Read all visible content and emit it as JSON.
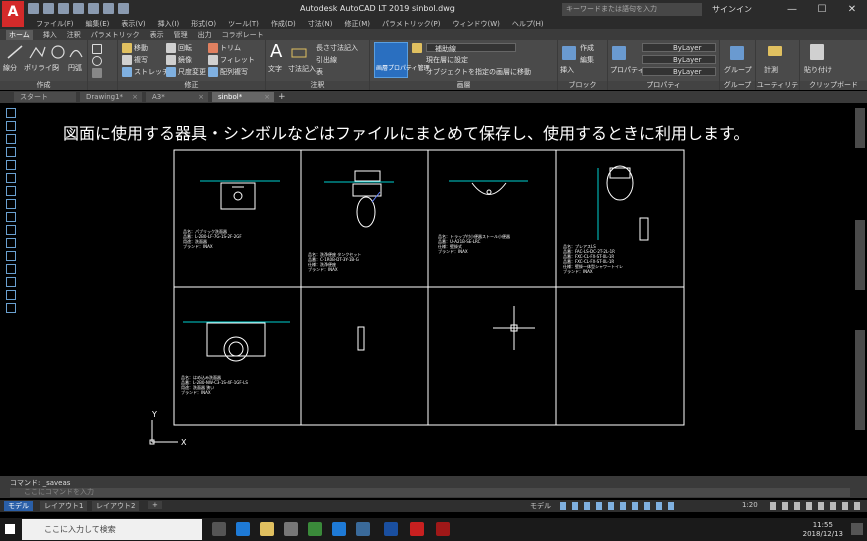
{
  "app": {
    "logo": "A",
    "title": "Autodesk AutoCAD LT 2019    sinbol.dwg",
    "search_placeholder": "キーワードまたは語句を入力",
    "signin": "サインイン"
  },
  "menu": [
    "ファイル(F)",
    "編集(E)",
    "表示(V)",
    "挿入(I)",
    "形式(O)",
    "ツール(T)",
    "作成(D)",
    "寸法(N)",
    "修正(M)",
    "パラメトリック(P)",
    "ウィンドウ(W)",
    "ヘルプ(H)"
  ],
  "ribbon_tabs": [
    "ホーム",
    "挿入",
    "注釈",
    "パラメトリック",
    "表示",
    "管理",
    "出力",
    "コラボレート"
  ],
  "ribbon_groups": {
    "draw": "作成",
    "modify": "修正",
    "annotation": "注釈",
    "image": "画層",
    "block": "ブロック",
    "properties": "プロパティ",
    "group": "グループ",
    "utility": "ユーティリティ",
    "clipboard": "クリップボード"
  },
  "ribbon_labels": {
    "line": "線分",
    "polyline": "ポリライン",
    "circle": "円",
    "arc": "円弧",
    "move": "移動",
    "rotate": "回転",
    "trim": "トリム",
    "copy": "複写",
    "mirror": "鏡像",
    "fillet": "フィレット",
    "stretch": "ストレッチ",
    "scale": "尺度変更",
    "array": "配列複写",
    "text": "文字",
    "dimension": "寸法記入",
    "linear": "長さ寸法記入",
    "leader": "引出線",
    "table": "表",
    "layer_props": "画層プロパティ管理",
    "layer_current": "現在層に設定",
    "layer_match": "オブジェクトを指定の画層に移動",
    "layer_name": "補助線",
    "insert": "挿入",
    "create": "作成",
    "edit": "編集",
    "bylayer1": "ByLayer",
    "bylayer2": "ByLayer",
    "bylayer3": "ByLayer",
    "properties_btn": "プロパティ",
    "group_btn": "グループ",
    "measure": "計測",
    "paste": "貼り付け"
  },
  "doc_tabs": [
    "スタート",
    "Drawing1*",
    "A3*",
    "sinbol*"
  ],
  "heading": "図面に使用する器具・シンボルなどはファイルにまとめて保存し、使用するときに利用します。",
  "cells": [
    {
      "lines": [
        "品名：パブリック洗面器",
        "品番：L-2B0-LF-7G-1S-2F-2GF",
        "用途：洗面器",
        "ブランド：INAX"
      ]
    },
    {
      "lines": [
        "品名：洗浄便座 タンクセット",
        "品番：C-1R0B-DT-3Y-1B-G",
        "仕様：洗浄便座",
        "ブランド：INAX"
      ]
    },
    {
      "lines": [
        "品名：トラップ付小便器ストール小便器",
        "品番：U-A21B-SE-LRC",
        "仕様：壁掛式",
        "ブランド：INAX"
      ]
    },
    {
      "lines": [
        "品名：プレアスLS",
        "品番：FAC-LS-DC-2T-2L-1R",
        "品番：FXC-CL-FX-ST-0L-1R",
        "品番：FXC-CL-FX-ST-0L-1R",
        "仕様：壁掛一体型シャワートイレ",
        "ブランド：INAX"
      ]
    },
    {
      "lines": [
        "品名：はめ込み洗面器",
        "品番：L-2B0-NW-C3-1S-4F-1GF-LS",
        "用途：洗面器 狭い",
        "ブランド：INAX"
      ]
    }
  ],
  "command": {
    "history": "コマンド: _saveas",
    "placeholder": "ここにコマンドを入力"
  },
  "layout_tabs": [
    "モデル",
    "レイアウト1",
    "レイアウト2"
  ],
  "status": {
    "model_label": "モデル",
    "scale": "1:20"
  },
  "taskbar": {
    "search": "ここに入力して検索",
    "time": "11:55",
    "date": "2018/12/13"
  }
}
